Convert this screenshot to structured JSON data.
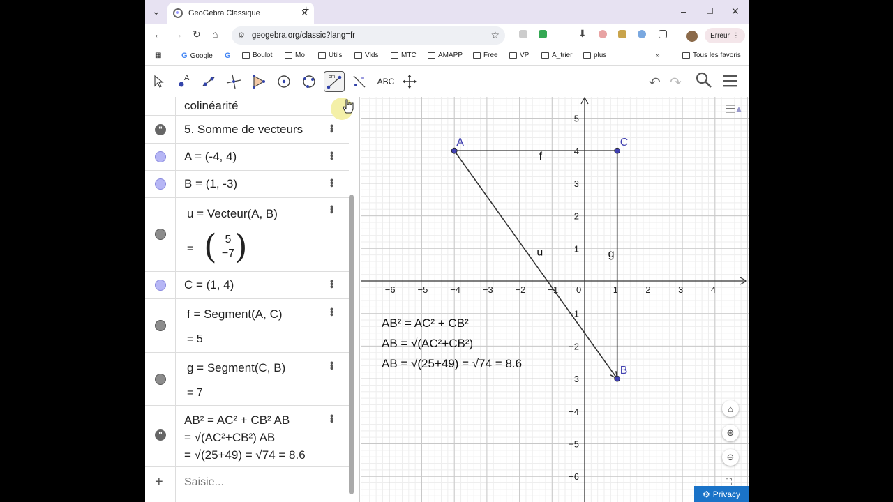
{
  "browser": {
    "tab_title": "GeoGebra Classique",
    "url": "geogebra.org/classic?lang=fr",
    "profile_label": "Erreur",
    "bookmarks": [
      "Google",
      "Boulot",
      "Mo",
      "Utils",
      "Vlds",
      "MTC",
      "AMAPP",
      "Free",
      "VP",
      "A_trier",
      "plus",
      "Tous les favoris"
    ]
  },
  "toolbar": {
    "abc_label": "ABC",
    "active_tool_caption": "cm"
  },
  "algebra": {
    "rows": [
      {
        "kind": "text",
        "line1": "colinéarité"
      },
      {
        "kind": "text",
        "line1": "5. Somme de vecteurs"
      },
      {
        "kind": "point",
        "line1": "A = (-4, 4)"
      },
      {
        "kind": "point",
        "line1": "B = (1, -3)"
      },
      {
        "kind": "vector",
        "line1": "u = Vecteur(A, B)",
        "eq": "=",
        "v1": "5",
        "v2": "−7"
      },
      {
        "kind": "point",
        "line1": "C = (1, 4)"
      },
      {
        "kind": "segment",
        "line1": "f = Segment(A, C)",
        "line2": "= 5"
      },
      {
        "kind": "segment",
        "line1": "g = Segment(C, B)",
        "line2": "= 7"
      },
      {
        "kind": "text",
        "line1": "AB² = AC² + CB² AB",
        "line2": "= √(AC²+CB²) AB",
        "line3": "= √(25+49) = √74 = 8.6"
      }
    ],
    "input_placeholder": "Saisie...",
    "add_symbol": "+"
  },
  "graphics": {
    "x_ticks": [
      "−6",
      "−5",
      "−4",
      "−3",
      "−2",
      "−1",
      "0",
      "1",
      "2",
      "3",
      "4"
    ],
    "y_ticks": [
      "5",
      "4",
      "3",
      "2",
      "1",
      "−1",
      "−2",
      "−3",
      "−4",
      "−5",
      "−6"
    ],
    "points": [
      {
        "name": "A",
        "x": -4,
        "y": 4
      },
      {
        "name": "B",
        "x": 1,
        "y": -3
      },
      {
        "name": "C",
        "x": 1,
        "y": 4
      }
    ],
    "labels": {
      "f": "f",
      "g": "g",
      "u": "u"
    },
    "text_lines": [
      "AB² = AC² + CB²",
      "AB = √(AC²+CB²)",
      "AB = √(25+49) = √74 = 8.6"
    ],
    "point_color": "#4040b0",
    "axis_range": {
      "xmin": -6,
      "xmax": 4,
      "ymin": -6,
      "ymax": 5
    }
  },
  "privacy_label": "Privacy"
}
